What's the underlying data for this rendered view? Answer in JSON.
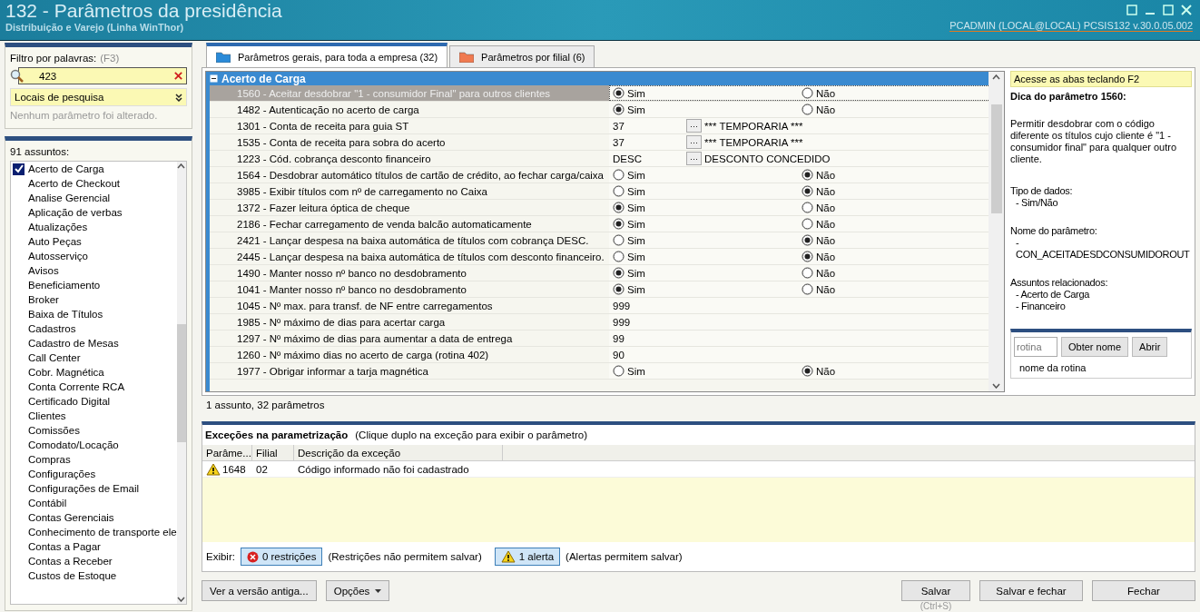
{
  "window": {
    "title": "132 - Parâmetros da presidência",
    "subtitle": "Distribuição e Varejo (Linha WinThor)",
    "session": "PCADMIN (LOCAL@LOCAL)   PCSIS132  v.30.0.05.002"
  },
  "filter": {
    "label": "Filtro por palavras:",
    "shortcut": "(F3)",
    "value": "423",
    "locations": "Locais de pesquisa",
    "status": "Nenhum parâmetro foi alterado."
  },
  "subjects": {
    "count": "91 assuntos:",
    "items": [
      {
        "label": "Acerto de Carga",
        "checked": true
      },
      {
        "label": "Acerto de Checkout",
        "checked": false
      },
      {
        "label": "Analise Gerencial",
        "checked": false
      },
      {
        "label": "Aplicação de verbas",
        "checked": false
      },
      {
        "label": "Atualizações",
        "checked": false
      },
      {
        "label": "Auto Peças",
        "checked": false
      },
      {
        "label": "Autosserviço",
        "checked": false
      },
      {
        "label": "Avisos",
        "checked": false
      },
      {
        "label": "Beneficiamento",
        "checked": false
      },
      {
        "label": "Broker",
        "checked": false
      },
      {
        "label": "Baixa de Títulos",
        "checked": false
      },
      {
        "label": "Cadastros",
        "checked": false
      },
      {
        "label": "Cadastro de Mesas",
        "checked": false
      },
      {
        "label": "Call Center",
        "checked": false
      },
      {
        "label": "Cobr. Magnética",
        "checked": false
      },
      {
        "label": "Conta Corrente RCA",
        "checked": false
      },
      {
        "label": "Certificado Digital",
        "checked": false
      },
      {
        "label": "Clientes",
        "checked": false
      },
      {
        "label": "Comissões",
        "checked": false
      },
      {
        "label": "Comodato/Locação",
        "checked": false
      },
      {
        "label": "Compras",
        "checked": false
      },
      {
        "label": "Configurações",
        "checked": false
      },
      {
        "label": "Configurações de Email",
        "checked": false
      },
      {
        "label": "Contábil",
        "checked": false
      },
      {
        "label": "Contas Gerenciais",
        "checked": false
      },
      {
        "label": "Conhecimento de transporte ele",
        "checked": false
      },
      {
        "label": "Contas a Pagar",
        "checked": false
      },
      {
        "label": "Contas a Receber",
        "checked": false
      },
      {
        "label": "Custos de Estoque",
        "checked": false
      }
    ]
  },
  "tabs": [
    {
      "label": "Parâmetros gerais, para toda a empresa  (32)",
      "selected": true
    },
    {
      "label": "Parâmetros por filial  (6)",
      "selected": false
    }
  ],
  "group": {
    "title": "Acerto de Carga",
    "expanded": true
  },
  "parameters": [
    {
      "kind": "radio",
      "label": "1560 - Aceitar desdobrar \"1 - consumidor Final\" para outros clientes",
      "selected": true,
      "options": [
        {
          "label": "Sim",
          "selected": true
        },
        {
          "label": "Não",
          "selected": false
        }
      ]
    },
    {
      "kind": "radio",
      "label": "1482 - Autenticação no acerto de carga",
      "selected": false,
      "options": [
        {
          "label": "Sim",
          "selected": true
        },
        {
          "label": "Não",
          "selected": false
        }
      ]
    },
    {
      "kind": "lookup",
      "label": "1301 - Conta de receita para guia ST",
      "selected": false,
      "value": "37",
      "button": "···",
      "description": "*** TEMPORARIA ***"
    },
    {
      "kind": "lookup",
      "label": "1535 - Conta de receita para sobra do acerto",
      "selected": false,
      "value": "37",
      "button": "···",
      "description": "*** TEMPORARIA ***"
    },
    {
      "kind": "lookup",
      "label": "1223 - Cód. cobrança desconto financeiro",
      "selected": false,
      "value": "DESC",
      "button": "···",
      "description": "DESCONTO CONCEDIDO"
    },
    {
      "kind": "radio",
      "label": "1564 - Desdobrar automático títulos de cartão de crédito, ao fechar carga/caixa",
      "selected": false,
      "options": [
        {
          "label": "Sim",
          "selected": false
        },
        {
          "label": "Não",
          "selected": true
        }
      ]
    },
    {
      "kind": "radio",
      "label": "3985 - Exibir títulos com nº de carregamento no Caixa",
      "selected": false,
      "options": [
        {
          "label": "Sim",
          "selected": false
        },
        {
          "label": "Não",
          "selected": true
        }
      ]
    },
    {
      "kind": "radio",
      "label": "1372 - Fazer leitura óptica de cheque",
      "selected": false,
      "options": [
        {
          "label": "Sim",
          "selected": true
        },
        {
          "label": "Não",
          "selected": false
        }
      ]
    },
    {
      "kind": "radio",
      "label": "2186 - Fechar carregamento de venda balcão automaticamente",
      "selected": false,
      "options": [
        {
          "label": "Sim",
          "selected": true
        },
        {
          "label": "Não",
          "selected": false
        }
      ]
    },
    {
      "kind": "radio",
      "label": "2421 - Lançar despesa na baixa automática de títulos com cobrança DESC.",
      "selected": false,
      "options": [
        {
          "label": "Sim",
          "selected": false
        },
        {
          "label": "Não",
          "selected": true
        }
      ]
    },
    {
      "kind": "radio",
      "label": "2445 - Lançar despesa na baixa automática de títulos com desconto financeiro.",
      "selected": false,
      "options": [
        {
          "label": "Sim",
          "selected": false
        },
        {
          "label": "Não",
          "selected": true
        }
      ]
    },
    {
      "kind": "radio",
      "label": "1490 - Manter nosso nº banco no desdobramento",
      "selected": false,
      "options": [
        {
          "label": "Sim",
          "selected": true
        },
        {
          "label": "Não",
          "selected": false
        }
      ]
    },
    {
      "kind": "radio",
      "label": "1041 - Manter nosso nº banco no desdobramento",
      "selected": false,
      "options": [
        {
          "label": "Sim",
          "selected": true
        },
        {
          "label": "Não",
          "selected": false
        }
      ]
    },
    {
      "kind": "number",
      "label": "1045 - Nº max. para transf. de NF entre carregamentos",
      "selected": false,
      "value": "999"
    },
    {
      "kind": "number",
      "label": "1985 - Nº máximo de dias para acertar carga",
      "selected": false,
      "value": "999"
    },
    {
      "kind": "number",
      "label": "1297 - Nº máximo de dias para aumentar a data de entrega",
      "selected": false,
      "value": "99"
    },
    {
      "kind": "number",
      "label": "1260 - Nº máximo dias no acerto de carga (rotina 402)",
      "selected": false,
      "value": "90"
    },
    {
      "kind": "radio",
      "label": "1977 - Obrigar informar a tarja magnética",
      "selected": false,
      "options": [
        {
          "label": "Sim",
          "selected": false
        },
        {
          "label": "Não",
          "selected": true
        }
      ]
    }
  ],
  "summary": "1 assunto, 32 parâmetros",
  "tip": {
    "hint": "Acesse as abas teclando F2",
    "title": "Dica do parâmetro 1560:",
    "text": "Permitir desdobrar com o código diferente os títulos cujo cliente é \"1 - consumidor final\" para qualquer outro cliente.",
    "sections": [
      {
        "heading": "Tipo de dados:",
        "lines": [
          "- Sim/Não"
        ]
      },
      {
        "heading": "Nome do parâmetro:",
        "lines": [
          "-",
          "CON_ACEITADESDCONSUMIDOROUT"
        ]
      },
      {
        "heading": "Assuntos relacionados:",
        "lines": [
          "- Acerto de Carga",
          "- Financeiro"
        ]
      }
    ],
    "routine": {
      "placeholder": "rotina",
      "get_name": "Obter nome",
      "open": "Abrir",
      "name": "nome da rotina"
    }
  },
  "exceptions": {
    "title": "Exceções na parametrização",
    "note": "(Clique duplo na exceção para exibir o parâmetro)",
    "columns": [
      "Parâme...",
      "Filial",
      "Descrição da exceção"
    ],
    "rows": [
      {
        "cells": [
          "1648",
          "02",
          "Código informado não foi cadastrado"
        ]
      }
    ],
    "show_label": "Exibir:",
    "restrictions": "0 restrições",
    "restrictions_note": "(Restrições não permitem salvar)",
    "alerts": "1 alerta",
    "alerts_note": "(Alertas permitem salvar)"
  },
  "footer": {
    "old_version": "Ver a versão antiga...",
    "options": "Opções",
    "save": "Salvar",
    "save_shortcut": "(Ctrl+S)",
    "save_close": "Salvar e fechar",
    "close": "Fechar"
  }
}
